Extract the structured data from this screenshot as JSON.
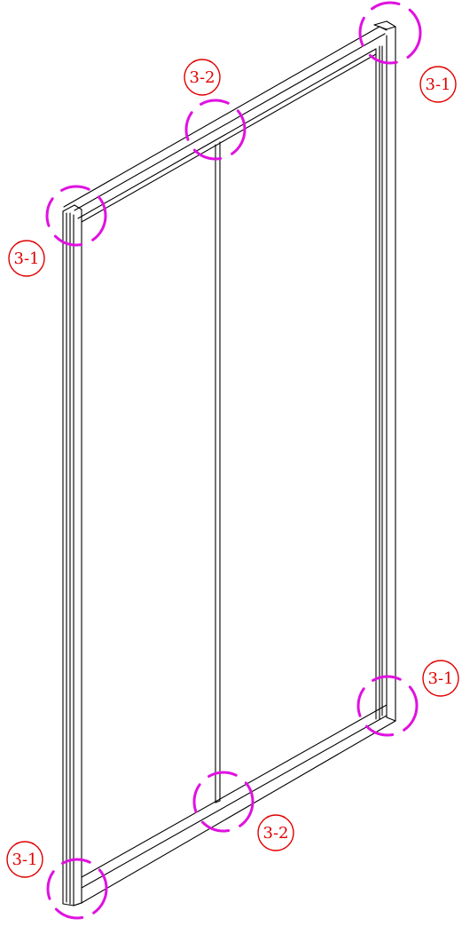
{
  "callouts": [
    {
      "id": "tr",
      "label": "3-1"
    },
    {
      "id": "tc",
      "label": "3-2"
    },
    {
      "id": "tl",
      "label": "3-1"
    },
    {
      "id": "br",
      "label": "3-1"
    },
    {
      "id": "bc",
      "label": "3-2"
    },
    {
      "id": "bl",
      "label": "3-1"
    }
  ],
  "colors": {
    "line": "#000000",
    "callout": "#e00000",
    "marker": "#e011e0",
    "background": "#ffffff"
  }
}
